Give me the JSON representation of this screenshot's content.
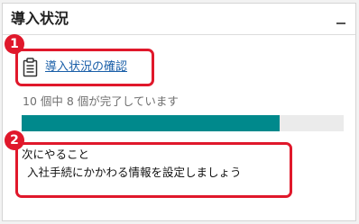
{
  "card": {
    "title": "導入状況",
    "collapse_symbol": "–"
  },
  "check_link": {
    "icon": "clipboard-icon",
    "label": "導入状況の確認"
  },
  "progress": {
    "text": "10 個中 8 個が完了しています",
    "completed": 8,
    "total": 10,
    "fill_color": "#00898c"
  },
  "next_action": {
    "heading": "次にやること",
    "detail": "入社手続にかかわる情報を設定しましょう"
  },
  "callouts": [
    {
      "number": "1"
    },
    {
      "number": "2"
    }
  ],
  "colors": {
    "callout_red": "#e0182b",
    "link_blue": "#1a5fa8"
  }
}
